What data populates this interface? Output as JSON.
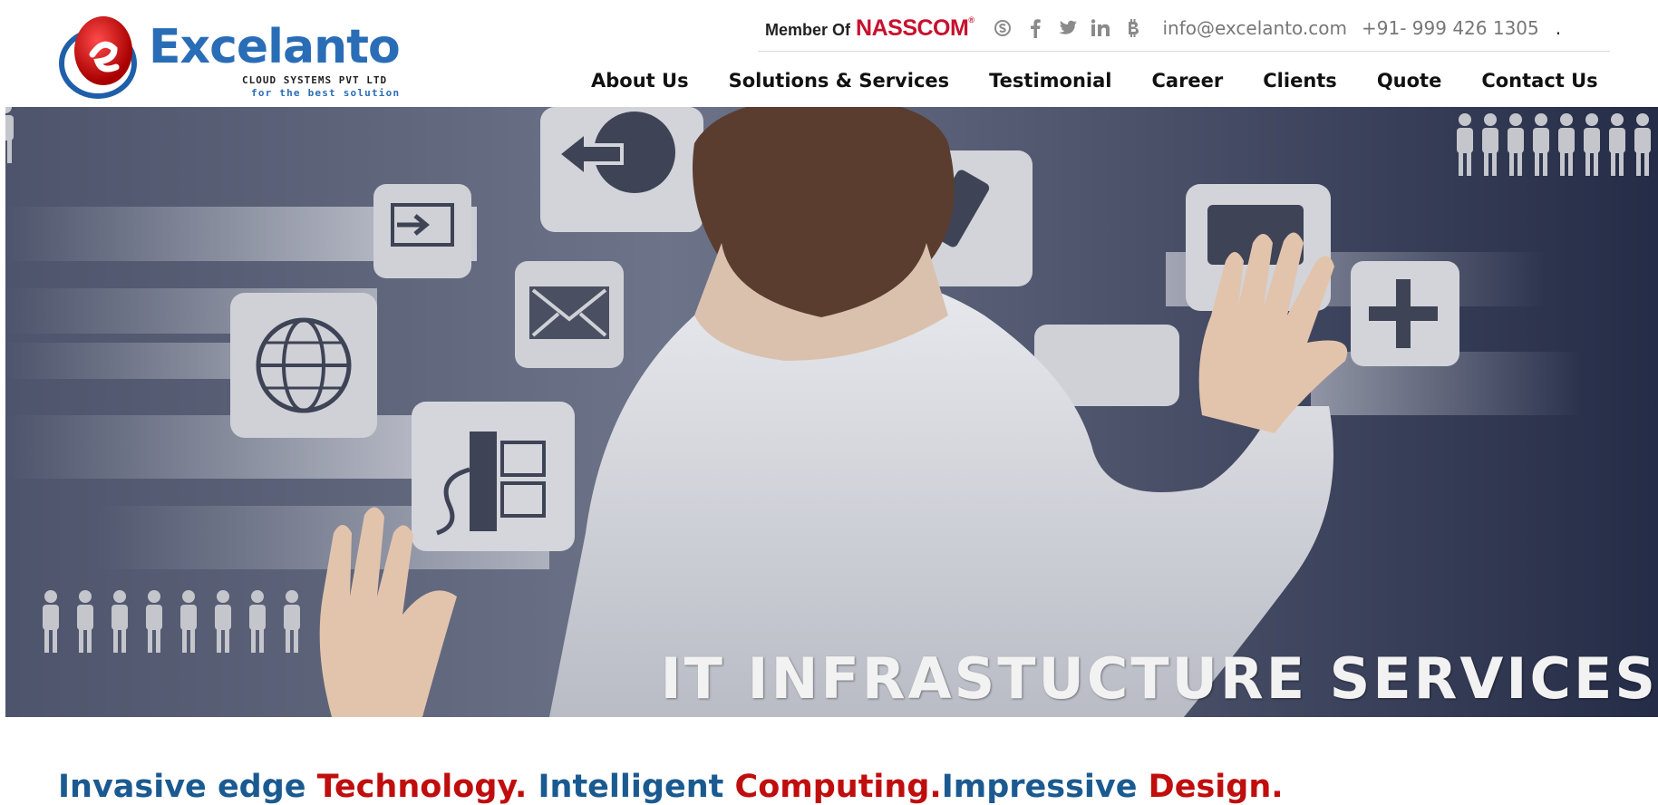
{
  "brand": {
    "name": "Excelanto",
    "subtitle": "CLOUD SYSTEMS PVT LTD",
    "tagline": "for the best solution"
  },
  "topbar": {
    "member_of": "Member Of",
    "nasscom": "NASSCOM",
    "social_icons": [
      "skype-icon",
      "facebook-icon",
      "twitter-icon",
      "linkedin-icon",
      "bitcoin-icon"
    ],
    "email": "info@excelanto.com",
    "phone": "+91- 999 426 1305",
    "trailing": "."
  },
  "nav": {
    "items": [
      "About Us",
      "Solutions & Services",
      "Testimonial",
      "Career",
      "Clients",
      "Quote",
      "Contact Us"
    ]
  },
  "hero": {
    "title": "IT INFRASTUCTURE SERVICES"
  },
  "tagline": {
    "part1": "Invasive edge ",
    "part2": "Technology. ",
    "part3": "Intelligent ",
    "part4": "Computing.",
    "part5": "Impressive ",
    "part6": "Design."
  },
  "colors": {
    "brand_blue": "#2a6db7",
    "brand_red": "#c8102e",
    "tagline_blue": "#1b5a91",
    "tagline_red": "#c00d0d"
  }
}
